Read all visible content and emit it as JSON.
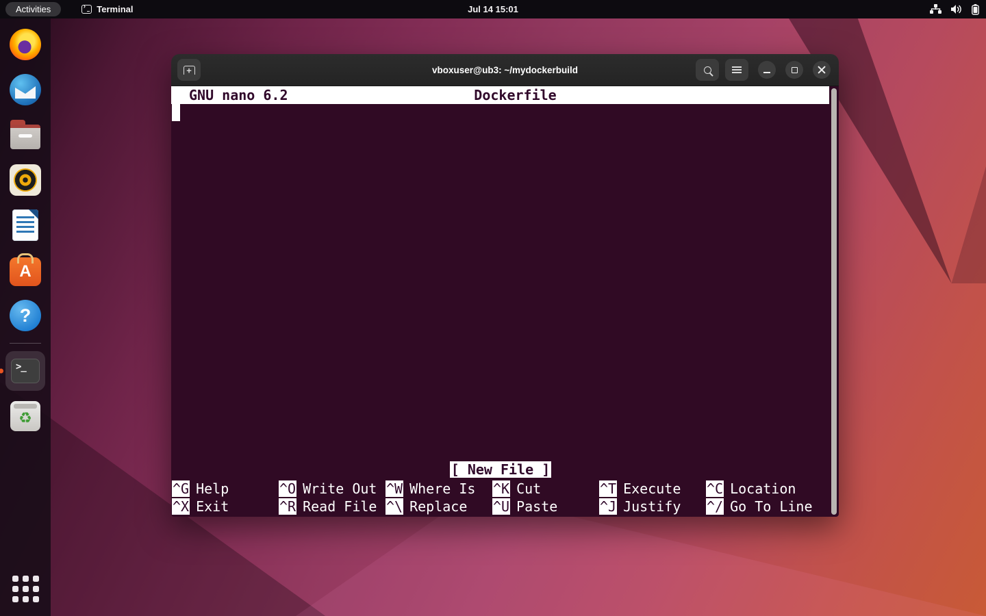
{
  "topbar": {
    "activities_label": "Activities",
    "focused_app": "Terminal",
    "clock": "Jul 14 15:01",
    "tray_icons": [
      "network-icon",
      "volume-icon",
      "battery-icon"
    ]
  },
  "dock": {
    "items": [
      {
        "name": "firefox"
      },
      {
        "name": "thunderbird"
      },
      {
        "name": "files"
      },
      {
        "name": "rhythmbox"
      },
      {
        "name": "libreoffice-writer"
      },
      {
        "name": "ubuntu-software"
      },
      {
        "name": "help"
      },
      {
        "name": "terminal",
        "active": true
      },
      {
        "name": "trash"
      },
      {
        "name": "app-grid"
      }
    ],
    "software_letter": "A",
    "help_glyph": "?",
    "trash_glyph": "♻"
  },
  "window": {
    "title": "vboxuser@ub3: ~/mydockerbuild",
    "buttons": [
      "new-tab",
      "search",
      "menu",
      "minimize",
      "maximize",
      "close"
    ]
  },
  "nano": {
    "version_label": "GNU nano 6.2",
    "filename": "Dockerfile",
    "status": "[ New File ]",
    "shortcut_rows": [
      {
        "items": [
          {
            "key": "^G",
            "label": "Help"
          },
          {
            "key": "^O",
            "label": "Write Out"
          },
          {
            "key": "^W",
            "label": "Where Is"
          },
          {
            "key": "^K",
            "label": "Cut"
          },
          {
            "key": "^T",
            "label": "Execute"
          },
          {
            "key": "^C",
            "label": "Location"
          }
        ]
      },
      {
        "items": [
          {
            "key": "^X",
            "label": "Exit"
          },
          {
            "key": "^R",
            "label": "Read File"
          },
          {
            "key": "^\\",
            "label": "Replace"
          },
          {
            "key": "^U",
            "label": "Paste"
          },
          {
            "key": "^J",
            "label": "Justify"
          },
          {
            "key": "^/",
            "label": "Go To Line"
          }
        ]
      }
    ]
  },
  "colors": {
    "terminal_bg": "#300a24",
    "topbar_bg": "#0d0b10",
    "headerbar_bg": "#262626",
    "accent_orange": "#e95420",
    "nano_reverse_fg": "#30082a"
  }
}
